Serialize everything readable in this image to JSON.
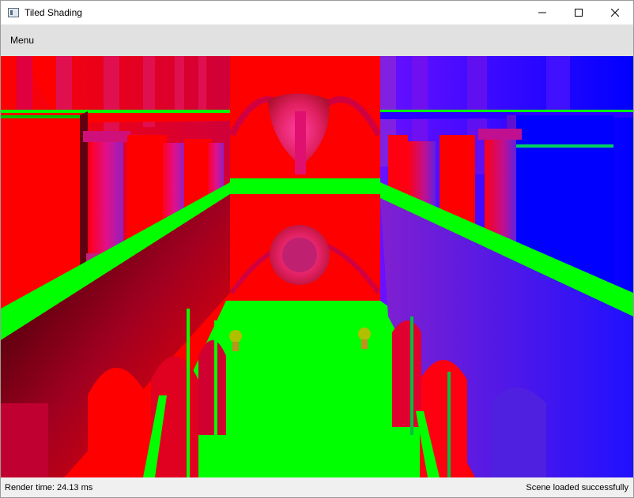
{
  "window": {
    "title": "Tiled Shading",
    "minimize_icon": "minimize-icon",
    "maximize_icon": "maximize-icon",
    "close_icon": "close-icon"
  },
  "menubar": {
    "items": [
      {
        "label": "Menu"
      }
    ]
  },
  "viewport": {
    "scene": "rendered-3d-scene",
    "colors": {
      "red": "#ff0000",
      "green": "#00ff00",
      "blue": "#0000ff",
      "magenta": "#b000ff"
    }
  },
  "statusbar": {
    "render_time": "Render time: 24.13 ms",
    "status_message": "Scene loaded successfully"
  }
}
